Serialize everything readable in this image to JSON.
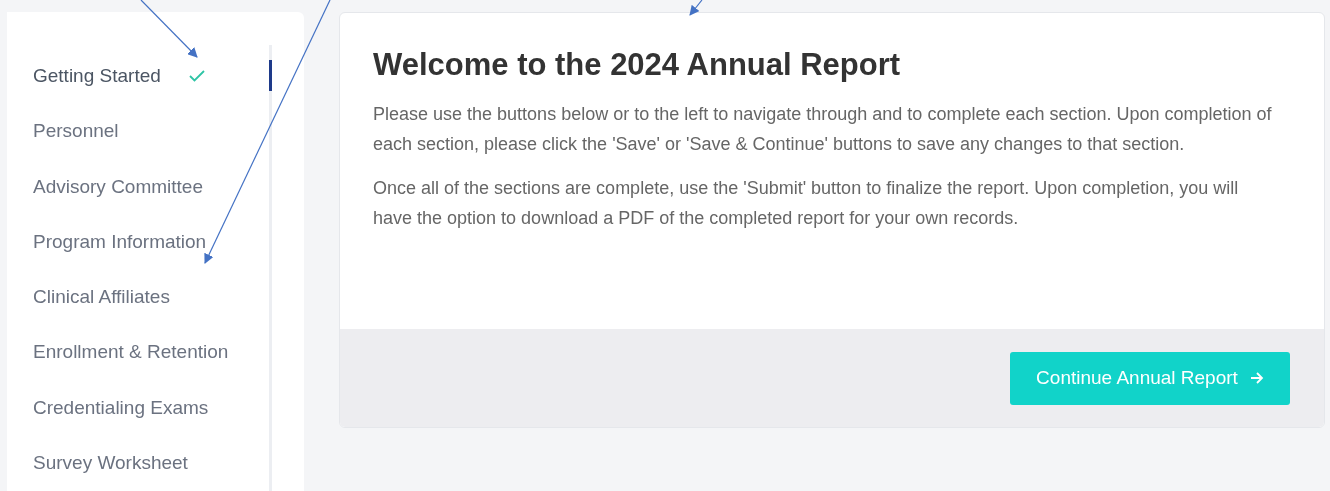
{
  "sidebar": {
    "items": [
      {
        "label": "Getting Started",
        "selected": true,
        "completed": true
      },
      {
        "label": "Personnel",
        "selected": false,
        "completed": false
      },
      {
        "label": "Advisory Committee",
        "selected": false,
        "completed": false
      },
      {
        "label": "Program Information",
        "selected": false,
        "completed": false
      },
      {
        "label": "Clinical Affiliates",
        "selected": false,
        "completed": false
      },
      {
        "label": "Enrollment & Retention",
        "selected": false,
        "completed": false
      },
      {
        "label": "Credentialing Exams",
        "selected": false,
        "completed": false
      },
      {
        "label": "Survey Worksheet",
        "selected": false,
        "completed": false
      }
    ]
  },
  "main": {
    "title": "Welcome to the 2024 Annual Report",
    "paragraphs": [
      "Please use the buttons below or to the left to navigate through and to complete each section. Upon completion of each section, please click the 'Save' or 'Save & Continue' buttons to save any changes to that section.",
      "Once all of the sections are complete, use the 'Submit' button to finalize the report. Upon completion, you will have the option to download a PDF of the completed report for your own records."
    ],
    "button": "Continue Annual Report"
  }
}
